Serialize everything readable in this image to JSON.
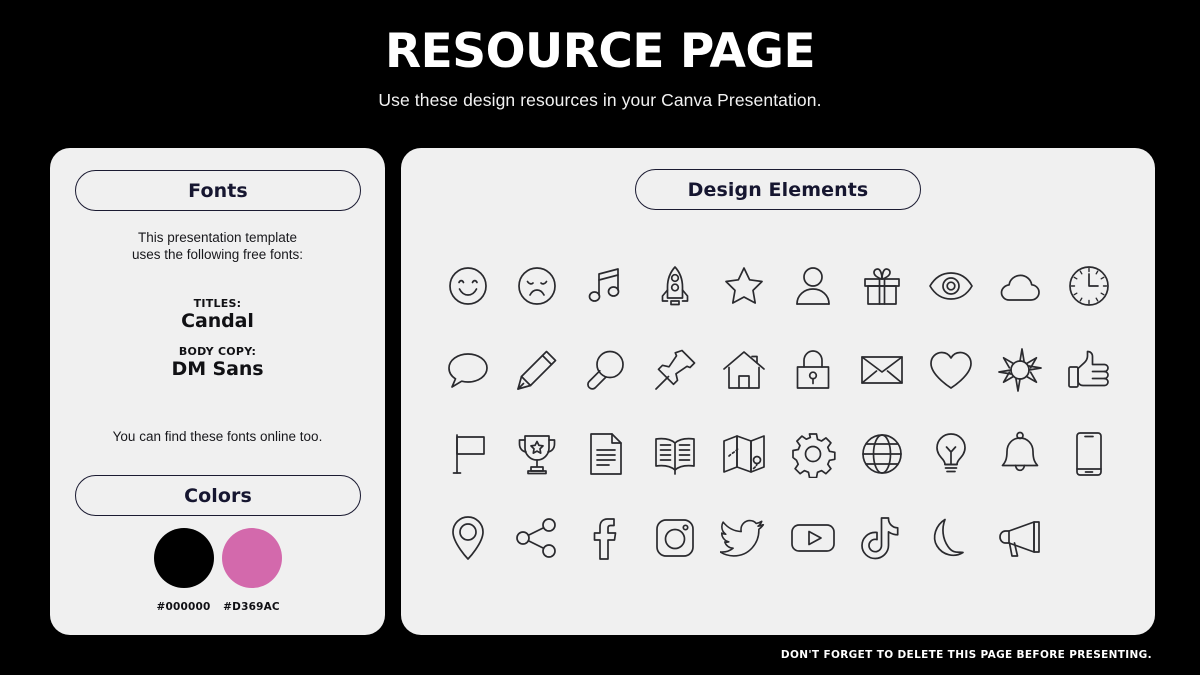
{
  "header": {
    "title": "RESOURCE PAGE",
    "subtitle": "Use these design resources in your Canva Presentation."
  },
  "fonts_panel": {
    "heading": "Fonts",
    "intro_line1": "This presentation template",
    "intro_line2": "uses the following free fonts:",
    "titles_label": "TITLES:",
    "titles_font": "Candal",
    "body_label": "BODY COPY:",
    "body_font": "DM Sans",
    "online_note": "You can find these fonts online too."
  },
  "colors_panel": {
    "heading": "Colors",
    "swatches": [
      {
        "hex": "#000000",
        "label": "#000000"
      },
      {
        "hex": "#D369AC",
        "label": "#D369AC"
      }
    ]
  },
  "elements_panel": {
    "heading": "Design Elements",
    "icons": [
      "smiley-face-icon",
      "sad-face-icon",
      "music-note-icon",
      "rocket-icon",
      "star-icon",
      "user-icon",
      "gift-icon",
      "eye-icon",
      "cloud-icon",
      "clock-icon",
      "speech-bubble-icon",
      "pencil-icon",
      "magnifier-icon",
      "push-pin-icon",
      "house-icon",
      "lock-icon",
      "envelope-icon",
      "heart-icon",
      "sun-icon",
      "thumbs-up-icon",
      "flag-icon",
      "trophy-icon",
      "document-icon",
      "open-book-icon",
      "map-icon",
      "gear-icon",
      "globe-icon",
      "lightbulb-icon",
      "bell-icon",
      "smartphone-icon",
      "location-pin-icon",
      "share-icon",
      "facebook-icon",
      "instagram-icon",
      "twitter-icon",
      "youtube-icon",
      "tiktok-icon",
      "moon-icon",
      "megaphone-icon"
    ]
  },
  "footer": {
    "note": "DON'T FORGET TO DELETE THIS PAGE BEFORE PRESENTING."
  }
}
